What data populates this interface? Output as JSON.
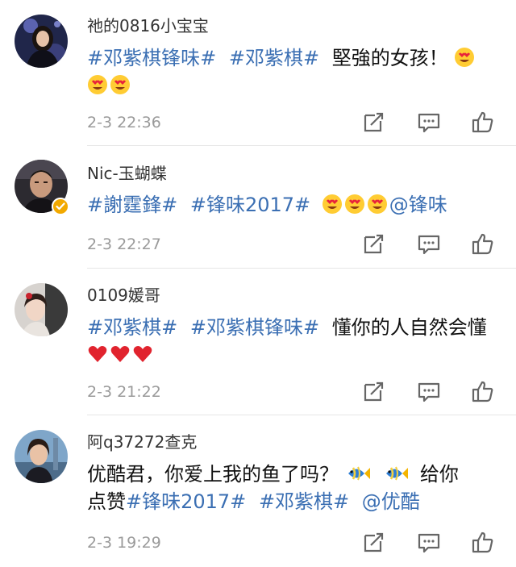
{
  "comments": [
    {
      "username": "祂的0816小宝宝",
      "time": "2-3 22:36",
      "tags": [
        "#邓紫棋锋味#",
        "#邓紫棋#"
      ],
      "text": "堅強的女孩！",
      "emojis": [
        "heart-eyes-emoji",
        "heart-eyes-emoji",
        "heart-eyes-emoji"
      ],
      "verified": false
    },
    {
      "username": "Nic-玉蝴蝶",
      "time": "2-3 22:27",
      "tags": [
        "#謝霆鋒#",
        "#锋味2017#"
      ],
      "emojis": [
        "heart-eyes-emoji",
        "heart-eyes-emoji",
        "heart-eyes-emoji"
      ],
      "mention": "@锋味",
      "verified": true
    },
    {
      "username": "0109媛哥",
      "time": "2-3 21:22",
      "tags": [
        "#邓紫棋#",
        "#邓紫棋锋味#"
      ],
      "text": "懂你的人自然会懂",
      "emojis": [
        "red-heart-emoji",
        "red-heart-emoji",
        "red-heart-emoji"
      ],
      "verified": false
    },
    {
      "username": "阿q37272查克",
      "time": "2-3 19:29",
      "text": "优酷君，你爱上我的鱼了吗？",
      "text2": "给你",
      "text3": "点赞",
      "tags": [
        "#锋味2017#",
        "#邓紫棋#"
      ],
      "mention": "@优酷",
      "emojis": [
        "tropical-fish-emoji",
        "tropical-fish-emoji"
      ],
      "verified": false
    }
  ],
  "colors": {
    "link": "#3b6fb3",
    "time": "#9a9a9a",
    "icon": "#666666",
    "divider": "#e6e6e6",
    "verified": "#f2a900"
  }
}
